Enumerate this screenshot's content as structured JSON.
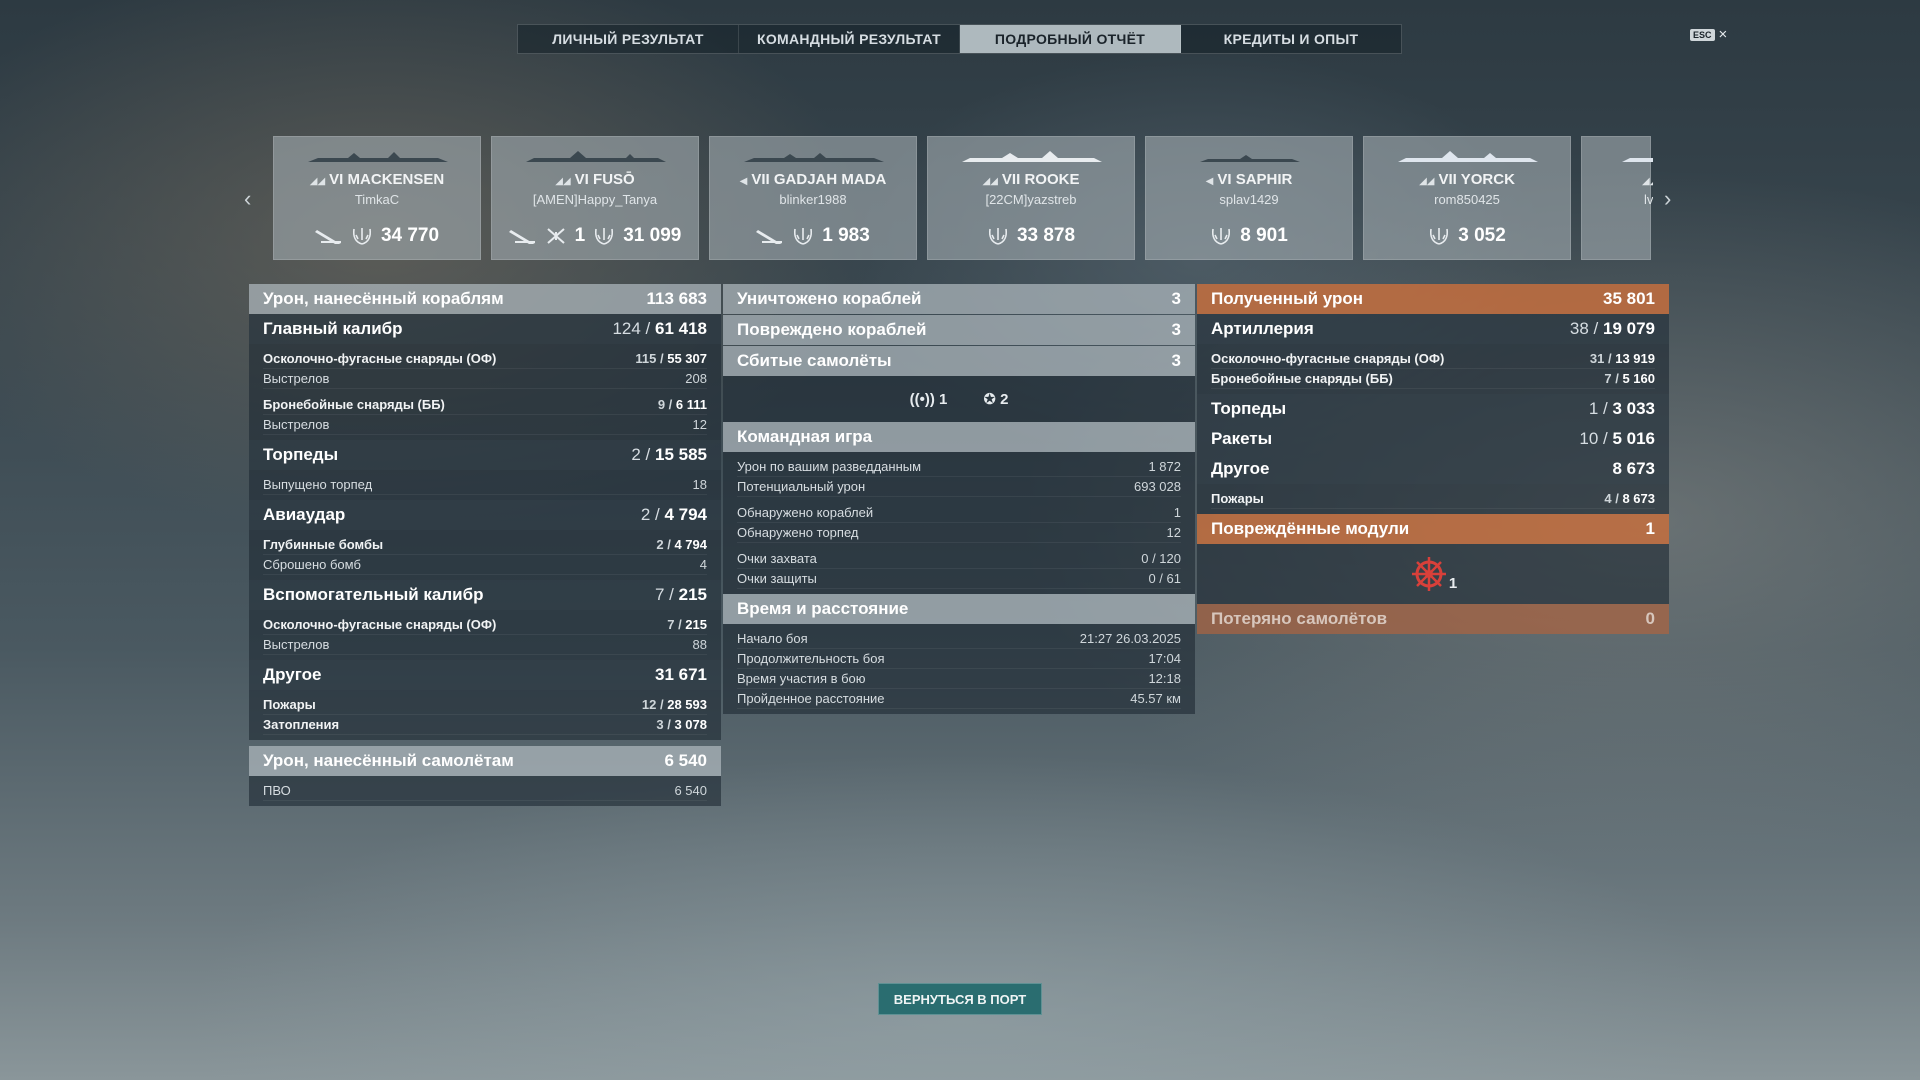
{
  "tabs": [
    {
      "label": "ЛИЧНЫЙ РЕЗУЛЬТАТ"
    },
    {
      "label": "КОМАНДНЫЙ РЕЗУЛЬТАТ"
    },
    {
      "label": "ПОДРОБНЫЙ ОТЧЁТ"
    },
    {
      "label": "КРЕДИТЫ И ОПЫТ"
    }
  ],
  "active_tab": "ПОДРОБНЫЙ ОТЧЁТ",
  "close": {
    "key": "ESC",
    "icon": "×"
  },
  "ships": [
    {
      "tier": "VI",
      "name": "MACKENSEN",
      "player": "TimkaC",
      "torpedo": true,
      "planes": "",
      "score": "34 770"
    },
    {
      "tier": "VI",
      "name": "FUSŌ",
      "player": "[AMEN]Happy_Tanya",
      "torpedo": true,
      "planes": "1",
      "score": "31 099"
    },
    {
      "tier": "VII",
      "name": "GADJAH MADA",
      "player": "blinker1988",
      "torpedo": true,
      "planes": "",
      "score": "1 983"
    },
    {
      "tier": "VII",
      "name": "ROOKE",
      "player": "[22CM]yazstreb",
      "torpedo": false,
      "planes": "",
      "score": "33 878"
    },
    {
      "tier": "VI",
      "name": "SAPHIR",
      "player": "splav1429",
      "torpedo": false,
      "planes": "",
      "score": "8 901"
    },
    {
      "tier": "VII",
      "name": "YORCK",
      "player": "rom850425",
      "torpedo": false,
      "planes": "",
      "score": "3 052"
    },
    {
      "tier": "",
      "name": "",
      "player": "lv",
      "torpedo": false,
      "planes": "",
      "score": ""
    }
  ],
  "left": {
    "ship_damage": {
      "label": "Урон, нанесённый кораблям",
      "value": "113 683"
    },
    "main_battery": {
      "label": "Главный калибр",
      "hits": "124",
      "dmg": "61 418"
    },
    "he_label": "Осколочно-фугасные снаряды (ОФ)",
    "he_hits": "115",
    "he_dmg": "55 307",
    "shots_label": "Выстрелов",
    "he_shots": "208",
    "ap_label": "Бронебойные снаряды (ББ)",
    "ap_hits": "9",
    "ap_dmg": "6 111",
    "ap_shots": "12",
    "torpedoes": {
      "label": "Торпеды",
      "hits": "2",
      "dmg": "15 585"
    },
    "torp_launched_label": "Выпущено торпед",
    "torp_launched": "18",
    "air": {
      "label": "Авиаудар",
      "hits": "2",
      "dmg": "4 794"
    },
    "depth_label": "Глубинные бомбы",
    "depth_hits": "2",
    "depth_dmg": "4 794",
    "bombs_label": "Сброшено бомб",
    "bombs": "4",
    "secondary": {
      "label": "Вспомогательный калибр",
      "hits": "7",
      "dmg": "215"
    },
    "sec_he_label": "Осколочно-фугасные снаряды (ОФ)",
    "sec_he_hits": "7",
    "sec_he_dmg": "215",
    "sec_shots": "88",
    "other": {
      "label": "Другое",
      "value": "31 671"
    },
    "fires_label": "Пожары",
    "fires_n": "12",
    "fires_dmg": "28 593",
    "flood_label": "Затопления",
    "flood_n": "3",
    "flood_dmg": "3 078",
    "aircraft_damage": {
      "label": "Урон, нанесённый самолётам",
      "value": "6 540"
    },
    "aa_label": "ПВО",
    "aa": "6 540"
  },
  "middle": {
    "destroyed": {
      "label": "Уничтожено кораблей",
      "value": "3"
    },
    "damaged": {
      "label": "Повреждено кораблей",
      "value": "3"
    },
    "planes_down": {
      "label": "Сбитые самолёты",
      "value": "3"
    },
    "plane_type_a": "1",
    "plane_type_b": "2",
    "team": {
      "label": "Командная игра"
    },
    "spotting_dmg_label": "Урон по вашим разведданным",
    "spotting_dmg": "1 872",
    "potential_label": "Потенциальный урон",
    "potential": "693 028",
    "ships_spotted_label": "Обнаружено кораблей",
    "ships_spotted": "1",
    "torps_spotted_label": "Обнаружено торпед",
    "torps_spotted": "12",
    "capture_label": "Очки захвата",
    "capture": "0 / 120",
    "defense_label": "Очки защиты",
    "defense": "0 / 61",
    "time": {
      "label": "Время и расстояние"
    },
    "start_label": "Начало боя",
    "start": "21:27  26.03.2025",
    "duration_label": "Продолжительность боя",
    "duration": "17:04",
    "participation_label": "Время участия в бою",
    "participation": "12:18",
    "distance_label": "Пройденное расстояние",
    "distance": "45.57 км"
  },
  "right": {
    "received": {
      "label": "Полученный урон",
      "value": "35 801"
    },
    "artillery": {
      "label": "Артиллерия",
      "hits": "38",
      "dmg": "19 079"
    },
    "he_label": "Осколочно-фугасные снаряды (ОФ)",
    "he_hits": "31",
    "he_dmg": "13 919",
    "ap_label": "Бронебойные снаряды (ББ)",
    "ap_hits": "7",
    "ap_dmg": "5 160",
    "torpedoes": {
      "label": "Торпеды",
      "hits": "1",
      "dmg": "3 033"
    },
    "rockets": {
      "label": "Ракеты",
      "hits": "10",
      "dmg": "5 016"
    },
    "other": {
      "label": "Другое",
      "value": "8 673"
    },
    "fires_label": "Пожары",
    "fires_n": "4",
    "fires_dmg": "8 673",
    "modules": {
      "label": "Повреждённые модули",
      "value": "1"
    },
    "module_count": "1",
    "planes_lost": {
      "label": "Потеряно самолётов",
      "value": "0"
    }
  },
  "back_button": "ВЕРНУТЬСЯ В ПОРТ",
  "colors": {
    "accent_orange": "#c46e3e",
    "button_teal": "#2a6d70",
    "module_red": "#d8403a"
  }
}
